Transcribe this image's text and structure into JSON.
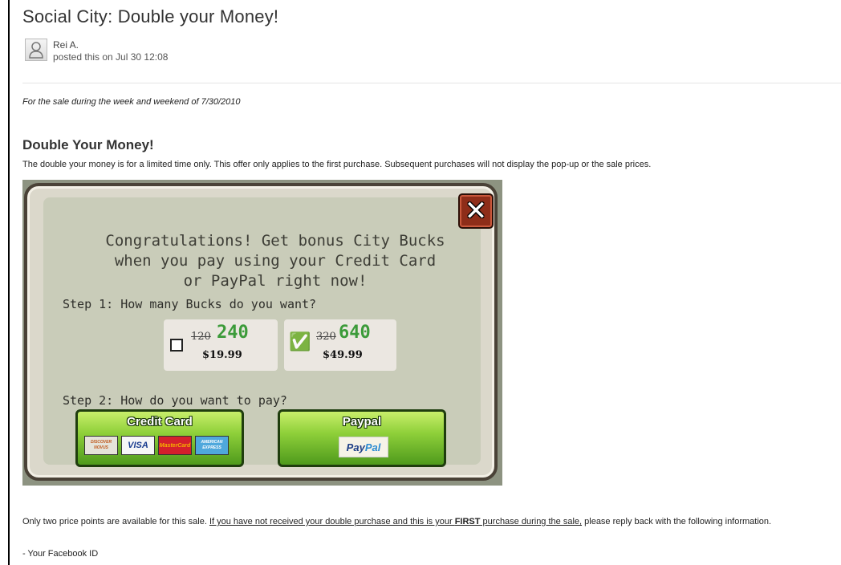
{
  "post": {
    "title": "Social City: Double your Money!",
    "author": "Rei A.",
    "posted": "posted this on Jul 30 12:08",
    "sale_note": "For the sale during the week and weekend of 7/30/2010",
    "heading": "Double Your Money!",
    "intro": "The double your money is for a limited time only. This offer only applies to the first purchase. Subsequent purchases will not display the pop-up or the sale prices."
  },
  "popup": {
    "close_icon": "close-icon",
    "congrats_line1": "Congratulations! Get bonus City Bucks",
    "congrats_line2": "when you pay using your Credit Card",
    "congrats_line3": "or PayPal right now!",
    "step1": "Step 1: How many Bucks do you want?",
    "step2": "Step 2: How do you want to pay?",
    "options": [
      {
        "old": "120",
        "new": "240",
        "price": "$19.99",
        "selected": false
      },
      {
        "old": "320",
        "new": "640",
        "price": "$49.99",
        "selected": true
      }
    ],
    "credit_card_label": "Credit Card",
    "cards": [
      "DISCOVER NOVUS",
      "VISA",
      "MasterCard",
      "AMERICAN EXPRESS"
    ],
    "paypal_label": "Paypal",
    "paypal_logo_1": "Pay",
    "paypal_logo_2": "Pal"
  },
  "footer": {
    "text_before": "Only two price points are available for this sale. ",
    "link_1": "If you have not received your double purchase and this is your ",
    "link_bold": "FIRST",
    "link_2": " purchase during the sale,",
    "text_after": " please reply back with the following information.",
    "item_1": "- Your Facebook ID"
  },
  "colors": {
    "bucks_green": "#3c9b3a",
    "button_green": "#8fd03a",
    "close_red": "#8e2d19"
  }
}
